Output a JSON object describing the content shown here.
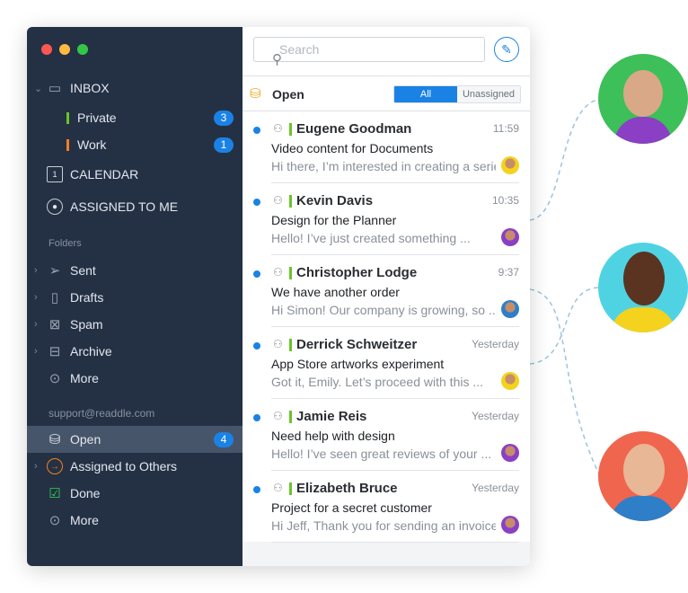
{
  "sidebar": {
    "inbox": "INBOX",
    "private": "Private",
    "private_count": "3",
    "work": "Work",
    "work_count": "1",
    "calendar": "CALENDAR",
    "calendar_day": "1",
    "assigned_to_me": "ASSIGNED TO ME",
    "folders_header": "Folders",
    "folders": [
      {
        "label": "Sent",
        "icon": "send-icon"
      },
      {
        "label": "Drafts",
        "icon": "document-icon"
      },
      {
        "label": "Spam",
        "icon": "spam-icon"
      },
      {
        "label": "Archive",
        "icon": "archive-icon"
      },
      {
        "label": "More",
        "icon": "more-icon"
      }
    ],
    "account": "support@readdle.com",
    "shared": [
      {
        "label": "Open",
        "count": "4"
      },
      {
        "label": "Assigned to Others"
      },
      {
        "label": "Done"
      },
      {
        "label": "More"
      }
    ]
  },
  "colors": {
    "sidebar": "#243145",
    "accent": "#1b82e5",
    "private": "#6ac42b",
    "work": "#f0801f"
  },
  "list": {
    "search_placeholder": "Search",
    "folder_title": "Open",
    "filter_all": "All",
    "filter_unassigned": "Unassigned",
    "messages": [
      {
        "sender": "Eugene Goodman",
        "time": "11:59",
        "subject": "Video content for Documents",
        "preview": "Hi there, I’m interested in creating a series"
      },
      {
        "sender": "Kevin Davis",
        "time": "10:35",
        "subject": "Design for the Planner",
        "preview": "Hello! I’ve just created something ..."
      },
      {
        "sender": "Christopher Lodge",
        "time": "9:37",
        "subject": "We have another order",
        "preview": "Hi Simon! Our company is growing, so ..."
      },
      {
        "sender": "Derrick Schweitzer",
        "time": "Yesterday",
        "subject": "App Store artworks experiment",
        "preview": "Got it, Emily. Let’s proceed with this ..."
      },
      {
        "sender": "Jamie Reis",
        "time": "Yesterday",
        "subject": "Need help with design",
        "preview": "Hello! I’ve seen great reviews of your ..."
      },
      {
        "sender": "Elizabeth Bruce",
        "time": "Yesterday",
        "subject": "Project for a secret customer",
        "preview": "Hi Jeff, Thank you for sending an invoice"
      }
    ]
  }
}
